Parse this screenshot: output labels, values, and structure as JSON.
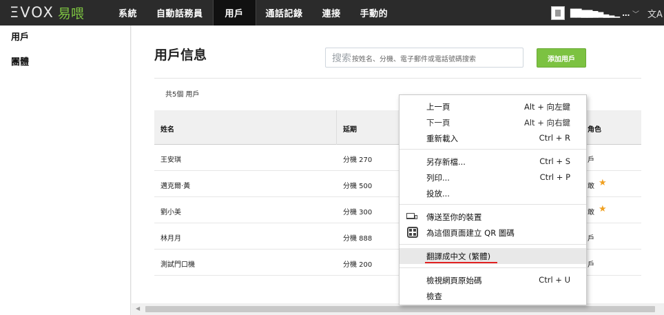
{
  "topbar": {
    "logo_mark": "ΞVOX",
    "logo_cn": "易喂",
    "nav": [
      "系統",
      "自動話務員",
      "用戶",
      "通話記錄",
      "連接",
      "手動的"
    ],
    "active_nav": "用戶",
    "user_name": "██▇▇▆▅▃▂▁ ..."
  },
  "sidebar": {
    "items": [
      "用戶",
      "團體"
    ]
  },
  "main": {
    "title": "用戶信息",
    "search": {
      "label": "搜索",
      "placeholder": "按姓名、分機、電子郵件或電話號碼搜索"
    },
    "add_button": "添加用戶",
    "count": "共5個 用戶",
    "columns": [
      "姓名",
      "延期",
      "角色"
    ],
    "rows": [
      {
        "name": "王安琪",
        "ext": "分機 270",
        "role": "戶",
        "star": false
      },
      {
        "name": "邁克爾·黃",
        "ext": "分機 500",
        "role": "敢",
        "star": true
      },
      {
        "name": "劉小美",
        "ext": "分機 300",
        "role": "敢",
        "star": true
      },
      {
        "name": "林月月",
        "ext": "分機 888",
        "role": "戶",
        "star": false
      },
      {
        "name": "測試門口機",
        "ext": "分機 200",
        "role": "戶",
        "star": false
      }
    ]
  },
  "context_menu": {
    "back": {
      "label": "上一頁",
      "shortcut": "Alt + 向左鍵"
    },
    "forward": {
      "label": "下一頁",
      "shortcut": "Alt + 向右鍵"
    },
    "reload": {
      "label": "重新載入",
      "shortcut": "Ctrl + R"
    },
    "save_as": {
      "label": "另存新檔...",
      "shortcut": "Ctrl + S"
    },
    "print": {
      "label": "列印...",
      "shortcut": "Ctrl + P"
    },
    "cast": {
      "label": "投放..."
    },
    "send_to_device": {
      "label": "傳送至你的裝置"
    },
    "create_qr": {
      "label": "為這個頁面建立 QR 圖碼"
    },
    "translate": {
      "label": "翻譯成中文 (繁體)"
    },
    "view_source": {
      "label": "檢視網頁原始碼",
      "shortcut": "Ctrl + U"
    },
    "inspect": {
      "label": "檢查"
    }
  },
  "colors": {
    "accent": "#7cc241",
    "topbar": "#2b2b2b",
    "star": "#f0a020"
  }
}
